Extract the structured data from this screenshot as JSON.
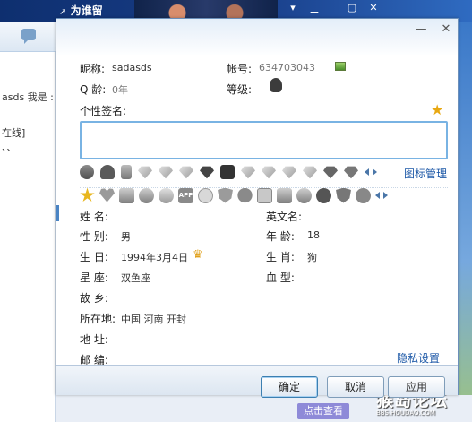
{
  "background": {
    "window_title": "为谁留",
    "left_texts": [
      "asds 我是 :",
      "在线]",
      "、、"
    ],
    "view_button": "点击查看",
    "watermark_title": "猴岛论坛",
    "watermark_url": "BBS.HOUDAO.COM"
  },
  "dialog": {
    "basic": {
      "nickname_label": "昵称:",
      "nickname_value": "sadasds",
      "account_label": "帐号:",
      "account_value": "634703043",
      "qage_label": "Q 龄:",
      "qage_value": "0年",
      "level_label": "等级:",
      "signature_label": "个性签名:",
      "signature_value": ""
    },
    "icon_manage_link": "图标管理",
    "privacy_link": "隐私设置",
    "profile": {
      "name_label": "姓    名:",
      "name_value": "",
      "english_name_label": "英文名:",
      "english_name_value": "",
      "gender_label": "性    别:",
      "gender_value": "男",
      "age_label": "年    龄:",
      "age_value": "18",
      "birthday_label": "生    日:",
      "birthday_value": "1994年3月4日",
      "zodiac_label": "生    肖:",
      "zodiac_value": "狗",
      "constellation_label": "星    座:",
      "constellation_value": "双鱼座",
      "blood_label": "血    型:",
      "blood_value": "",
      "hometown_label": "故    乡:",
      "hometown_value": "",
      "location_label": "所在地:",
      "location_value": "中国  河南  开封",
      "address_label": "地    址:",
      "address_value": "",
      "postcode_label": "邮    编:",
      "postcode_value": ""
    },
    "buttons": {
      "ok": "确定",
      "cancel": "取消",
      "apply": "应用"
    }
  }
}
